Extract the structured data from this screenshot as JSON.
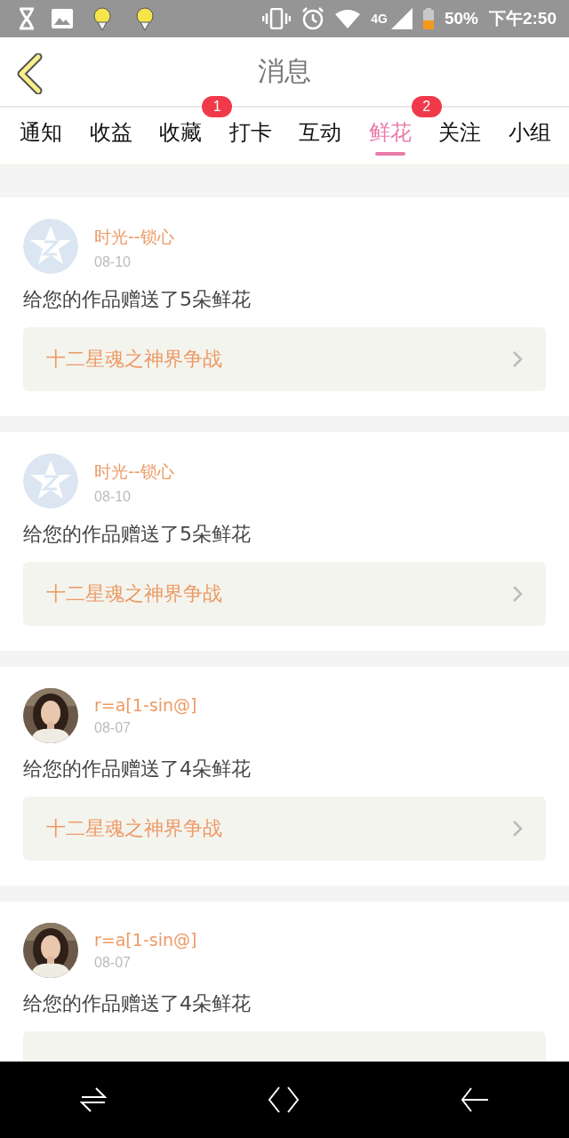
{
  "status_bar": {
    "network": "4G",
    "battery": "50%",
    "time": "下午2:50"
  },
  "header": {
    "title": "消息"
  },
  "tabs": [
    {
      "label": "通知",
      "selected": false
    },
    {
      "label": "收益",
      "selected": false
    },
    {
      "label": "收藏",
      "selected": false,
      "badge": "1"
    },
    {
      "label": "打卡",
      "selected": false
    },
    {
      "label": "互动",
      "selected": false
    },
    {
      "label": "鲜花",
      "selected": true,
      "badge": "2"
    },
    {
      "label": "关注",
      "selected": false
    },
    {
      "label": "小组",
      "selected": false
    }
  ],
  "messages": [
    {
      "user": "时光--锁心",
      "kind": "default",
      "date": "08-10",
      "text": "给您的作品赠送了5朵鲜花",
      "work": "十二星魂之神界争战"
    },
    {
      "user": "时光--锁心",
      "kind": "default",
      "date": "08-10",
      "text": "给您的作品赠送了5朵鲜花",
      "work": "十二星魂之神界争战"
    },
    {
      "user": "r=a[1-sin@]",
      "date": "08-07",
      "text": "给您的作品赠送了4朵鲜花",
      "work": "十二星魂之神界争战"
    },
    {
      "user": "r=a[1-sin@]",
      "date": "08-07",
      "text": "给您的作品赠送了4朵鲜花"
    }
  ]
}
